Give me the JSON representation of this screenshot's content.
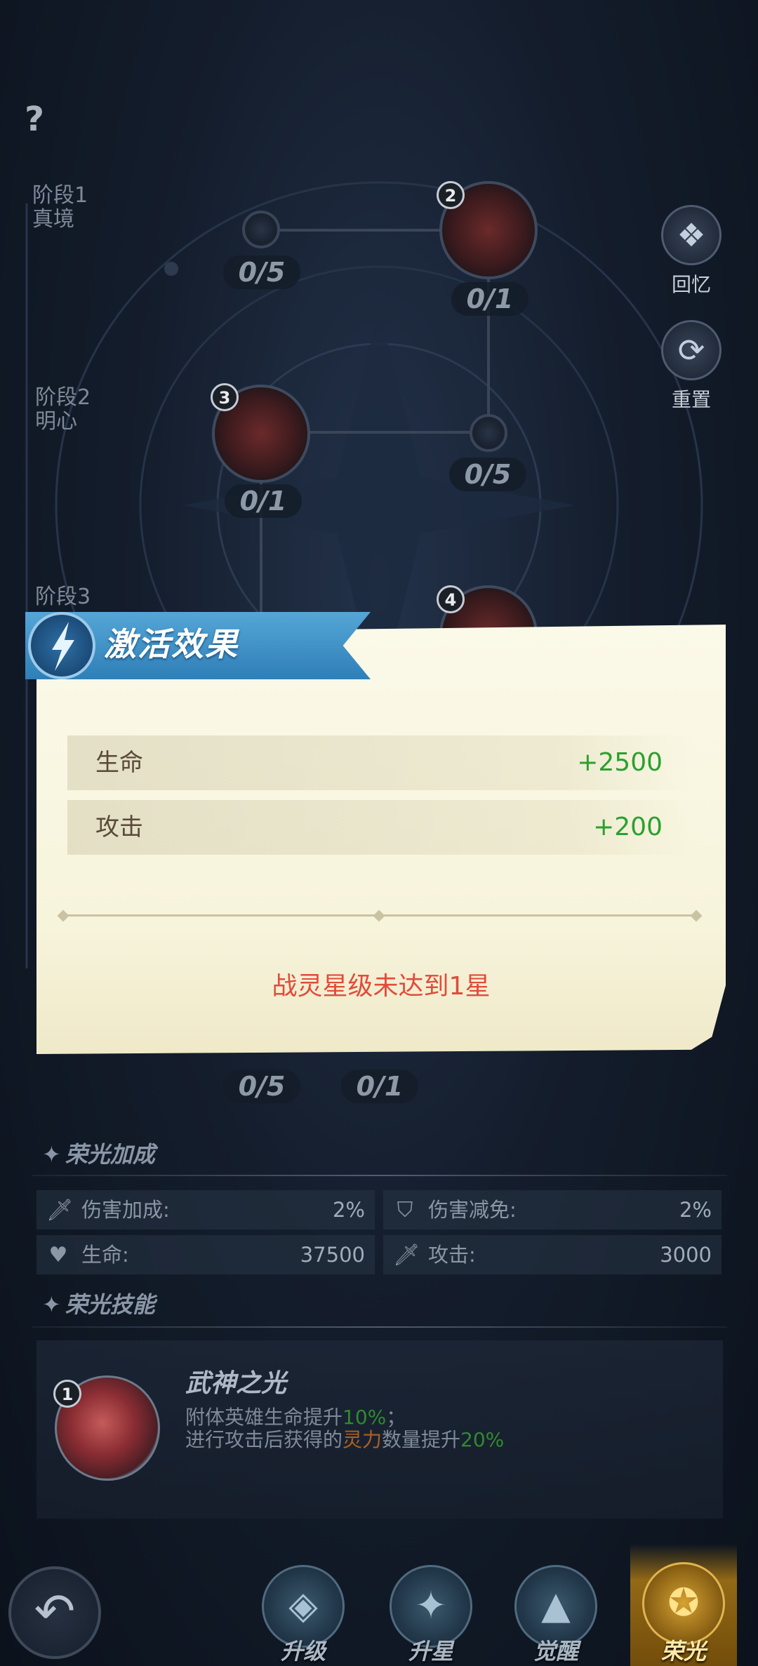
{
  "help": {
    "label": "?"
  },
  "tree": {
    "stages": [
      {
        "name": "阶段1",
        "sub": "真境"
      },
      {
        "name": "阶段2",
        "sub": "明心"
      },
      {
        "name": "阶段3",
        "sub": ""
      }
    ],
    "badges": [
      "2",
      "3",
      "4"
    ],
    "counts": [
      "0/5",
      "0/1",
      "0/1",
      "0/5",
      "0/5",
      "0/1"
    ]
  },
  "side": {
    "memory_label": "回忆",
    "reset_label": "重置"
  },
  "popup": {
    "title": "激活效果",
    "stats": [
      {
        "name": "生命",
        "value": "+2500"
      },
      {
        "name": "攻击",
        "value": "+200"
      }
    ],
    "warning": "战灵星级未达到1星"
  },
  "glory_bonus": {
    "title": "荣光加成",
    "attrs": [
      {
        "icon": "sword-icon",
        "label": "伤害加成:",
        "value": "2%"
      },
      {
        "icon": "shield-icon",
        "label": "伤害减免:",
        "value": "2%"
      },
      {
        "icon": "heart-icon",
        "label": "生命:",
        "value": "37500"
      },
      {
        "icon": "sword-icon",
        "label": "攻击:",
        "value": "3000"
      }
    ]
  },
  "glory_skill": {
    "title": "荣光技能",
    "badge": "1",
    "name": "武神之光",
    "line1_prefix": "附体英雄生命提升",
    "line1_pct": "10%",
    "line1_suffix": "；",
    "line2_prefix": "进行攻击后获得的",
    "line2_keyword": "灵力",
    "line2_mid": "数量提升",
    "line2_pct": "20%"
  },
  "nav": {
    "back_icon": "back-arrow-icon",
    "tabs": [
      {
        "label": "升级",
        "icon": "upgrade-icon"
      },
      {
        "label": "升星",
        "icon": "star-up-icon"
      },
      {
        "label": "觉醒",
        "icon": "awaken-icon"
      },
      {
        "label": "荣光",
        "icon": "glory-icon"
      }
    ],
    "active_tab": "荣光"
  }
}
